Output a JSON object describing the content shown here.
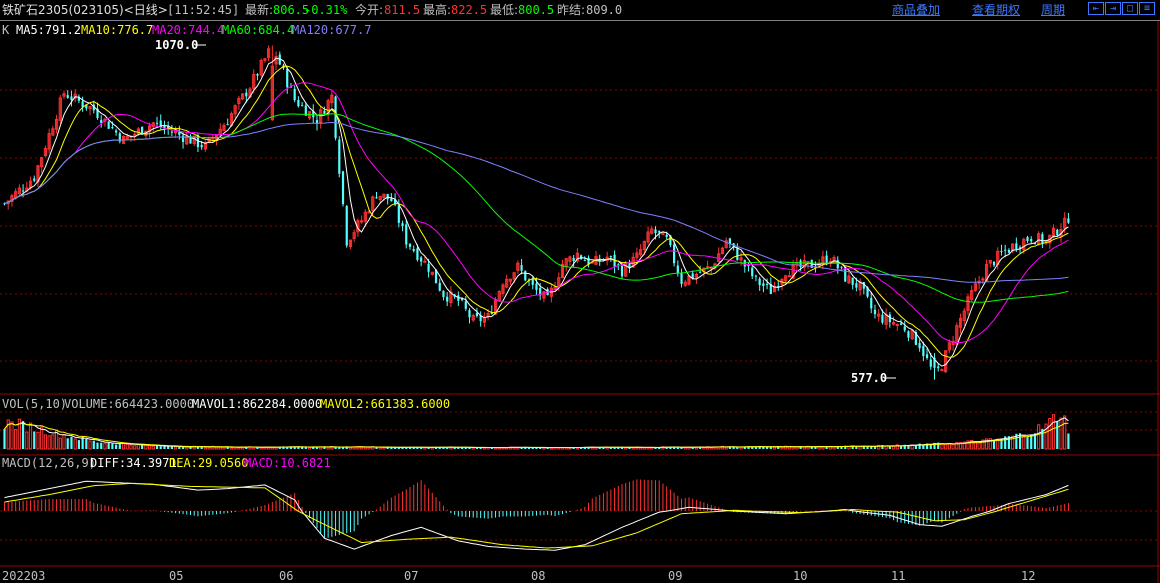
{
  "header": {
    "instrument": "铁矿石2305(023105)<日线>",
    "time": "[11:52:45]",
    "latest_label": "最新:",
    "latest_value": "806.5",
    "change_pct": "-0.31%",
    "open_label": "今开:",
    "open_value": "811.5",
    "high_label": "最高:",
    "high_value": "822.5",
    "low_label": "最低:",
    "low_value": "800.5",
    "prev_close_label": "昨结:",
    "prev_close_value": "809.0"
  },
  "toolbar": {
    "overlay_label": "商品叠加",
    "contract_label": "查看期权",
    "period_label": "周期",
    "nav_buttons": [
      "⇤",
      "⇥",
      "□",
      "≡"
    ]
  },
  "kline_legend": {
    "prefix": "K",
    "ma5": "MA5:791.2",
    "ma10": "MA10:776.7",
    "ma20": "MA20:744.4",
    "ma60": "MA60:684.4",
    "ma120": "MA120:677.7"
  },
  "annotations": {
    "high_marker": "1070.0",
    "low_marker": "577.0"
  },
  "vol_legend": {
    "name": "VOL(5,10)",
    "volume": "VOLUME:664423.0000",
    "mavol1": "MAVOL1:862284.0000",
    "mavol2": "MAVOL2:661383.6000"
  },
  "macd_legend": {
    "name": "MACD(12,26,9)",
    "diff": "DIFF:34.3971",
    "dea": "DEA:29.0560",
    "macd": "MACD:10.6821"
  },
  "x_axis": [
    "202203",
    "05",
    "06",
    "07",
    "08",
    "09",
    "10",
    "11",
    "12"
  ],
  "colors": {
    "up": "#ff3232",
    "down": "#54ffff",
    "ma5": "#ffffff",
    "ma10": "#ffff00",
    "ma20": "#ff00ff",
    "ma60": "#00ff00",
    "ma120": "#8080ff",
    "grid": "#8b0000",
    "link": "#3c78ff",
    "change": "#00ff00"
  },
  "chart_data": {
    "type": "candlestick",
    "price_range": [
      560,
      1085
    ],
    "last_price": 806.5,
    "price_path": [
      [
        0,
        835
      ],
      [
        8,
        875
      ],
      [
        16,
        1000
      ],
      [
        24,
        975
      ],
      [
        32,
        930
      ],
      [
        40,
        955
      ],
      [
        48,
        935
      ],
      [
        54,
        920
      ],
      [
        60,
        960
      ],
      [
        66,
        1010
      ],
      [
        72,
        1070
      ],
      [
        78,
        990
      ],
      [
        84,
        960
      ],
      [
        88,
        995
      ],
      [
        92,
        780
      ],
      [
        96,
        810
      ],
      [
        100,
        850
      ],
      [
        104,
        840
      ],
      [
        108,
        780
      ],
      [
        114,
        740
      ],
      [
        118,
        700
      ],
      [
        122,
        690
      ],
      [
        126,
        660
      ],
      [
        130,
        665
      ],
      [
        134,
        720
      ],
      [
        138,
        740
      ],
      [
        142,
        710
      ],
      [
        146,
        690
      ],
      [
        150,
        745
      ],
      [
        154,
        760
      ],
      [
        158,
        745
      ],
      [
        162,
        755
      ],
      [
        166,
        735
      ],
      [
        170,
        755
      ],
      [
        174,
        795
      ],
      [
        178,
        780
      ],
      [
        182,
        720
      ],
      [
        186,
        730
      ],
      [
        190,
        740
      ],
      [
        194,
        780
      ],
      [
        198,
        750
      ],
      [
        202,
        720
      ],
      [
        206,
        705
      ],
      [
        210,
        735
      ],
      [
        214,
        740
      ],
      [
        218,
        745
      ],
      [
        222,
        755
      ],
      [
        226,
        725
      ],
      [
        230,
        710
      ],
      [
        234,
        668
      ],
      [
        238,
        660
      ],
      [
        242,
        650
      ],
      [
        246,
        625
      ],
      [
        250,
        577
      ],
      [
        252,
        595
      ],
      [
        256,
        650
      ],
      [
        260,
        700
      ],
      [
        264,
        740
      ],
      [
        268,
        760
      ],
      [
        272,
        775
      ],
      [
        276,
        785
      ],
      [
        280,
        778
      ],
      [
        284,
        802
      ],
      [
        286,
        806.5
      ]
    ],
    "vol_path": [
      [
        0,
        0.7
      ],
      [
        6,
        0.62
      ],
      [
        14,
        0.42
      ],
      [
        24,
        0.2
      ],
      [
        40,
        0.08
      ],
      [
        60,
        0.05
      ],
      [
        80,
        0.06
      ],
      [
        100,
        0.05
      ],
      [
        140,
        0.04
      ],
      [
        180,
        0.05
      ],
      [
        220,
        0.07
      ],
      [
        240,
        0.09
      ],
      [
        256,
        0.16
      ],
      [
        266,
        0.24
      ],
      [
        274,
        0.4
      ],
      [
        280,
        0.62
      ],
      [
        284,
        1.0
      ],
      [
        286,
        0.55
      ]
    ],
    "macd_diff_path": [
      [
        0,
        18
      ],
      [
        12,
        30
      ],
      [
        22,
        40
      ],
      [
        30,
        38
      ],
      [
        40,
        36
      ],
      [
        52,
        28
      ],
      [
        60,
        30
      ],
      [
        70,
        35
      ],
      [
        78,
        15
      ],
      [
        86,
        -50
      ],
      [
        94,
        -70
      ],
      [
        104,
        -45
      ],
      [
        112,
        -30
      ],
      [
        122,
        -55
      ],
      [
        130,
        -65
      ],
      [
        140,
        -70
      ],
      [
        148,
        -72
      ],
      [
        156,
        -62
      ],
      [
        166,
        -30
      ],
      [
        176,
        -2
      ],
      [
        184,
        5
      ],
      [
        196,
        0
      ],
      [
        210,
        -5
      ],
      [
        226,
        2
      ],
      [
        238,
        -8
      ],
      [
        246,
        -25
      ],
      [
        252,
        -28
      ],
      [
        260,
        -10
      ],
      [
        270,
        10
      ],
      [
        280,
        22
      ],
      [
        286,
        34.4
      ]
    ],
    "macd_dea_path": [
      [
        0,
        12
      ],
      [
        12,
        22
      ],
      [
        24,
        34
      ],
      [
        34,
        37
      ],
      [
        50,
        33
      ],
      [
        70,
        31
      ],
      [
        84,
        -18
      ],
      [
        96,
        -58
      ],
      [
        108,
        -52
      ],
      [
        120,
        -48
      ],
      [
        134,
        -62
      ],
      [
        146,
        -68
      ],
      [
        158,
        -64
      ],
      [
        170,
        -40
      ],
      [
        182,
        -5
      ],
      [
        196,
        1
      ],
      [
        214,
        -3
      ],
      [
        228,
        2
      ],
      [
        240,
        -2
      ],
      [
        250,
        -18
      ],
      [
        258,
        -16
      ],
      [
        268,
        2
      ],
      [
        278,
        17
      ],
      [
        286,
        29.1
      ]
    ],
    "macd_range": [
      -90,
      55
    ],
    "vol_max_ratio": 1.0
  }
}
